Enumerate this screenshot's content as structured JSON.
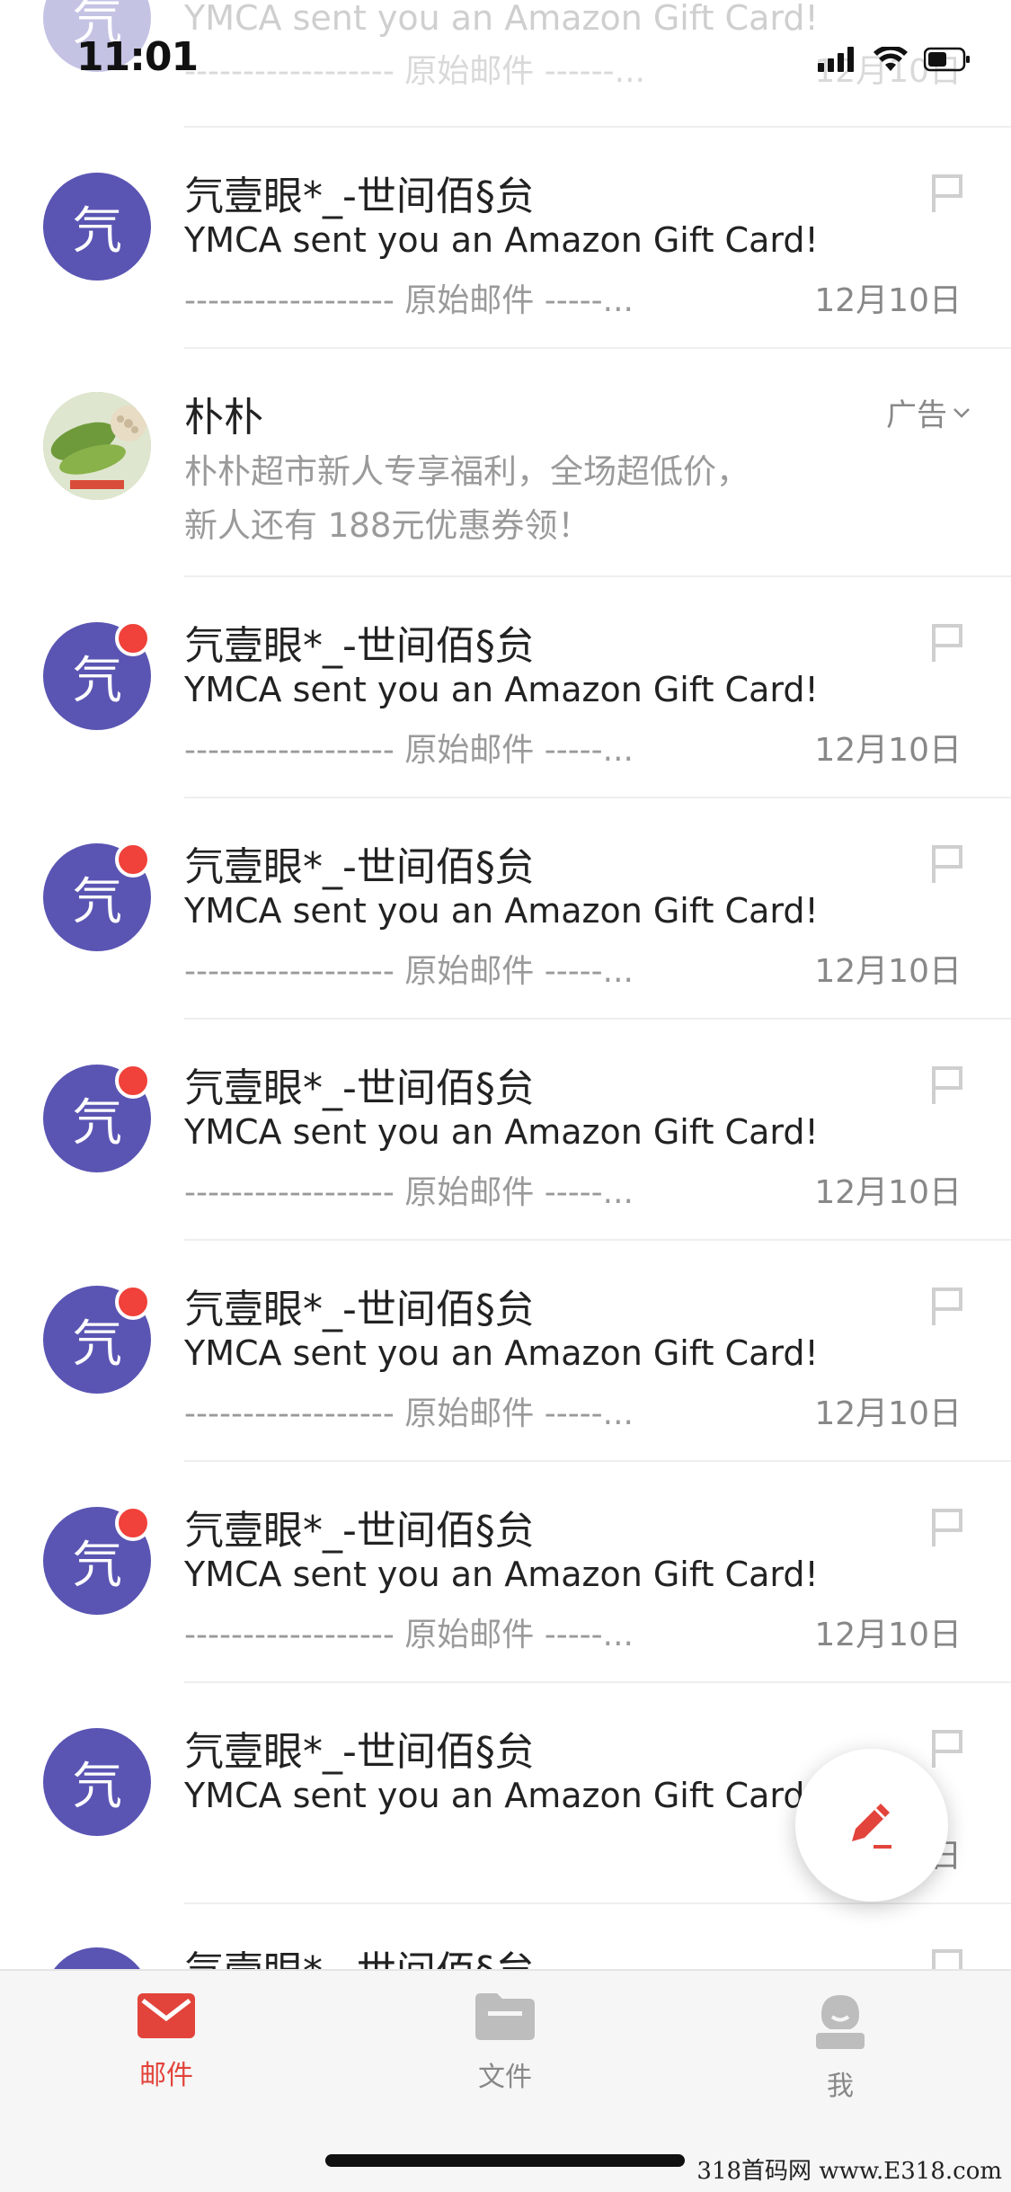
{
  "status": {
    "time": "11:01"
  },
  "top_partial": {
    "avatar_char": "氕",
    "subject": "YMCA sent you an Amazon Gift Card!",
    "preview": "------------------ 原始邮件 ------...",
    "date": "12月10日"
  },
  "emails": [
    {
      "avatar_char": "氕",
      "sender": "氕壹眼*_-世间佰§贠",
      "subject": "YMCA sent you an Amazon Gift Card!",
      "preview": "------------------ 原始邮件 -----...",
      "date": "12月10日",
      "unread": false
    },
    {
      "avatar_char": "氕",
      "sender": "氕壹眼*_-世间佰§贠",
      "subject": "YMCA sent you an Amazon Gift Card!",
      "preview": "------------------ 原始邮件 -----...",
      "date": "12月10日",
      "unread": true
    },
    {
      "avatar_char": "氕",
      "sender": "氕壹眼*_-世间佰§贠",
      "subject": "YMCA sent you an Amazon Gift Card!",
      "preview": "------------------ 原始邮件 -----...",
      "date": "12月10日",
      "unread": true
    },
    {
      "avatar_char": "氕",
      "sender": "氕壹眼*_-世间佰§贠",
      "subject": "YMCA sent you an Amazon Gift Card!",
      "preview": "------------------ 原始邮件 -----...",
      "date": "12月10日",
      "unread": true
    },
    {
      "avatar_char": "氕",
      "sender": "氕壹眼*_-世间佰§贠",
      "subject": "YMCA sent you an Amazon Gift Card!",
      "preview": "------------------ 原始邮件 -----...",
      "date": "12月10日",
      "unread": true
    },
    {
      "avatar_char": "氕",
      "sender": "氕壹眼*_-世间佰§贠",
      "subject": "YMCA sent you an Amazon Gift Card!",
      "preview": "------------------ 原始邮件 -----...",
      "date": "12月10日",
      "unread": true
    },
    {
      "avatar_char": "氕",
      "sender": "氕壹眼*_-世间佰§贠",
      "subject": "YMCA sent you an Amazon Gift Card!",
      "preview": "",
      "date": "日",
      "unread": false
    }
  ],
  "ad": {
    "sender": "朴朴",
    "label": "广告",
    "line1": "朴朴超市新人专享福利，全场超低价，",
    "line2": "新人还有 188元优惠券领！"
  },
  "bottom_partial": {
    "sender": "氕壹眼*_-世间佰§贠"
  },
  "tabs": [
    {
      "label": "邮件",
      "icon": "mail-icon",
      "active": true
    },
    {
      "label": "文件",
      "icon": "folder-icon",
      "active": false
    },
    {
      "label": "我",
      "icon": "profile-icon",
      "active": false
    }
  ],
  "watermark": "318首码网 www.E318.com",
  "colors": {
    "accent": "#e2443b",
    "avatar": "#5a55b3",
    "unread_dot": "#f0413a"
  }
}
